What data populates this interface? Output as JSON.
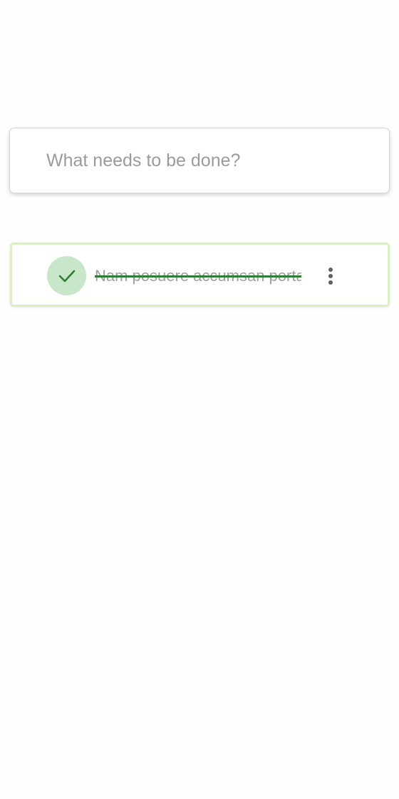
{
  "new_todo": {
    "placeholder": "What needs to be done?",
    "value": ""
  },
  "todos": [
    {
      "text": "Nam posuere accumsan porta",
      "completed": true,
      "check_icon": "check-icon",
      "menu_icon": "more-vertical-icon"
    }
  ],
  "colors": {
    "check_bg": "#c8e6c9",
    "check_mark": "#2e7d32",
    "item_border": "#dcefc7",
    "strike": "#2e7d32",
    "text_completed": "#9e9e9e",
    "placeholder": "#9b9b9b"
  }
}
